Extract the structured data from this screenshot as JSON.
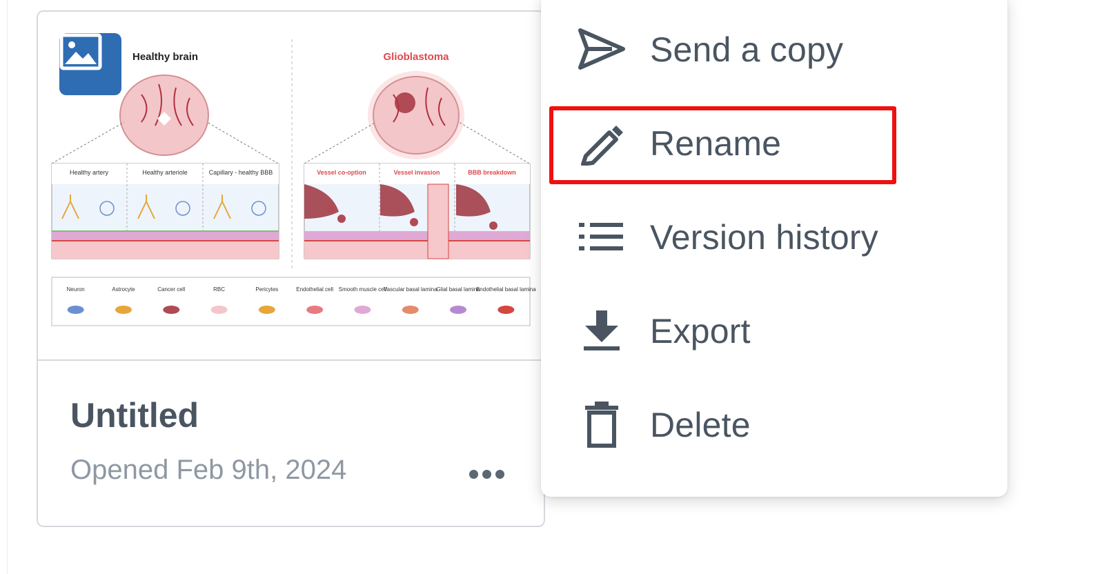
{
  "card": {
    "title": "Untitled",
    "subtitle": "Opened Feb 9th, 2024",
    "thumbnail": {
      "badge_icon": "image-icon",
      "badge_color": "#2f6db3",
      "left_heading": "Healthy brain",
      "right_heading": "Glioblastoma",
      "right_heading_color": "#e0484d",
      "left_panels": [
        "Healthy artery",
        "Healthy arteriole",
        "Capillary - healthy BBB"
      ],
      "right_panels": [
        "Vessel co-option",
        "Vessel invasion",
        "BBB breakdown"
      ],
      "legend": [
        {
          "label": "Neuron"
        },
        {
          "label": "Astrocyte"
        },
        {
          "label": "Cancer cell"
        },
        {
          "label": "RBC"
        },
        {
          "label": "Pericytes"
        },
        {
          "label": "Endothelial cell"
        },
        {
          "label": "Smooth muscle cell"
        },
        {
          "label": "Vascular basal lamina"
        },
        {
          "label": "Glial basal lamina"
        },
        {
          "label": "Endothelial basal lamina"
        }
      ]
    },
    "more_icon": "more-horizontal-icon"
  },
  "menu": {
    "items": [
      {
        "label": "Send a copy",
        "icon": "send-icon"
      },
      {
        "label": "Rename",
        "icon": "pencil-icon",
        "highlighted": true
      },
      {
        "label": "Version history",
        "icon": "list-icon"
      },
      {
        "label": "Export",
        "icon": "download-icon"
      },
      {
        "label": "Delete",
        "icon": "trash-icon"
      }
    ]
  },
  "colors": {
    "text": "#4a5561",
    "muted": "#8e98a3",
    "highlight": "#f01010",
    "border": "#d5d9de"
  }
}
